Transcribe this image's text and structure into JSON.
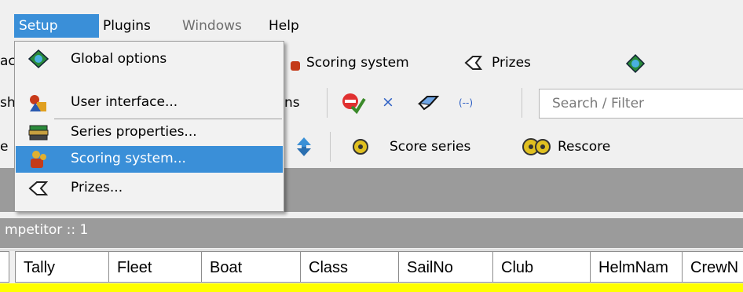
{
  "menubar": {
    "items": [
      {
        "label": "Setup",
        "active": true
      },
      {
        "label": "Plugins"
      },
      {
        "label": "Windows",
        "disabled": true
      },
      {
        "label": "Help"
      }
    ]
  },
  "setup_menu": {
    "items": [
      {
        "label": "Global options",
        "icon": "globe-icon"
      },
      {
        "label": "User interface...",
        "icon": "shapes-icon"
      },
      {
        "label": "Series properties...",
        "icon": "books-icon"
      },
      {
        "label": "Scoring system...",
        "icon": "people-icon",
        "highlighted": true
      },
      {
        "label": "Prizes...",
        "icon": "tag-icon"
      }
    ]
  },
  "toolbar1": {
    "partial_left": "ac",
    "scoring_label": "Scoring system",
    "prizes_label": "Prizes"
  },
  "toolbar2": {
    "partial_left": "sh",
    "partial_label": "ns",
    "clear_symbol": "×",
    "filter_symbol": "(--)",
    "search_placeholder": "Search / Filter"
  },
  "toolbar3": {
    "partial_left": "e",
    "score_series_label": "Score series",
    "rescore_label": "Rescore"
  },
  "panel": {
    "competitor_label": "mpetitor :: 1"
  },
  "table": {
    "columns": [
      "Tally",
      "Fleet",
      "Boat",
      "Class",
      "SailNo",
      "Club",
      "HelmNam",
      "CrewN"
    ]
  },
  "colors": {
    "highlight": "#3a8fd8",
    "panel_gray": "#9b9b9b",
    "row_yellow": "#ffff00"
  }
}
